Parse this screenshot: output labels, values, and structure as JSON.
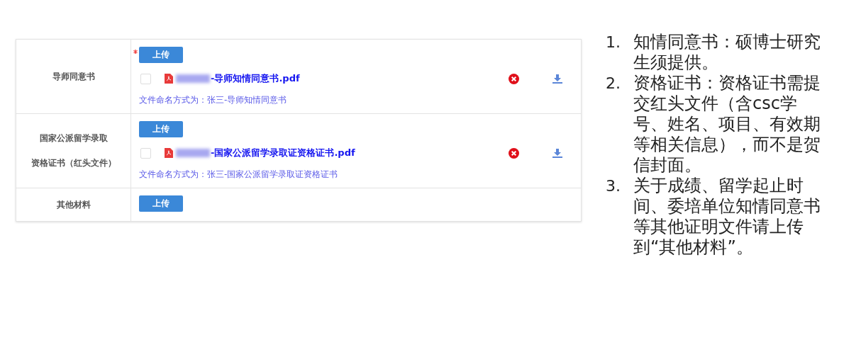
{
  "table": {
    "rows": [
      {
        "label_lines": [
          "导师同意书"
        ],
        "required": true,
        "upload_button": "上传",
        "file": {
          "checked": false,
          "name": "-导师知情同意书.pdf"
        },
        "hint": "文件命名方式为：张三-导师知情同意书"
      },
      {
        "label_lines": [
          "国家公派留学录取",
          "资格证书（红头文件）"
        ],
        "required": false,
        "upload_button": "上传",
        "file": {
          "checked": false,
          "name": "-国家公派留学录取证资格证书.pdf"
        },
        "hint": "文件命名方式为：张三-国家公派留学录取证资格证书"
      },
      {
        "label_lines": [
          "其他材料"
        ],
        "required": false,
        "upload_button": "上传"
      }
    ]
  },
  "notes": [
    {
      "number": "1.",
      "text": "知情同意书：硕博士研究生须提供。"
    },
    {
      "number": "2.",
      "text": "资格证书：资格证书需提交红头文件（含csc学号、姓名、项目、有效期等相关信息），而不是贺信封面。"
    },
    {
      "number": "3.",
      "text": "关于成绩、留学起止时间、委培单位知情同意书等其他证明文件请上传到“其他材料”。"
    }
  ]
}
